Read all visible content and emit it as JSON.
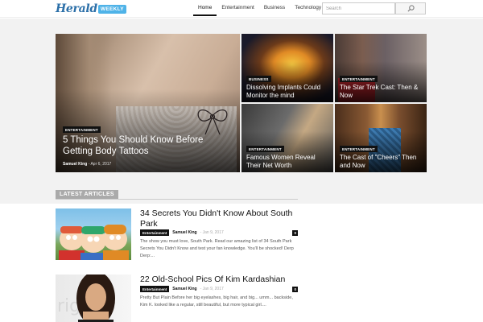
{
  "header": {
    "logo_main": "Herald",
    "logo_sub": "WEEKLY",
    "nav": [
      "Home",
      "Entertainment",
      "Business",
      "Technology"
    ],
    "active_nav": "Home",
    "search_placeholder": "Search",
    "icons": {
      "search": "search-icon"
    }
  },
  "featured": {
    "big": {
      "category": "ENTERTAINMENT",
      "title": "5 Things You Should Know Before Getting Body Tattoos",
      "author": "Samuel King",
      "date": "- Apr 6, 2017"
    },
    "tiles": [
      {
        "category": "BUSINESS",
        "title": "Dissolving Implants Could Monitor the mind"
      },
      {
        "category": "ENTERTAINMENT",
        "title": "The Star Trek Cast: Then & Now"
      },
      {
        "category": "ENTERTAINMENT",
        "title": "Famous Women Reveal Their Net Worth"
      },
      {
        "category": "ENTERTAINMENT",
        "title": "The Cast of \"Cheers\" Then and Now"
      }
    ]
  },
  "latest": {
    "heading": "LATEST ARTICLES",
    "articles": [
      {
        "title": "34 Secrets You Didn't Know About South Park",
        "category": "Entertainment",
        "author": "Samuel King",
        "date": "- Jan 9, 2017",
        "comments": "0",
        "excerpt": "The show you must love, South Park. Read our amazing list of 34 South Park Secrets You Didn't Know and test your fan knowledge. You'll be shocked!     Derp Derp:..."
      },
      {
        "title": "22 Old-School Pics Of Kim Kardashian",
        "category": "Entertainment",
        "author": "Samuel King",
        "date": "- Jan 9, 2017",
        "comments": "0",
        "excerpt": "Pretty But Plain Before her big eyelashes, big hair, and big... umm... backside, Kim K. looked like a regular, still beautiful, but more typical girl...."
      }
    ]
  },
  "colors": {
    "brand": "#2b6fa8",
    "accent": "#4fb3e8",
    "label_gray": "#aaaaaa"
  }
}
